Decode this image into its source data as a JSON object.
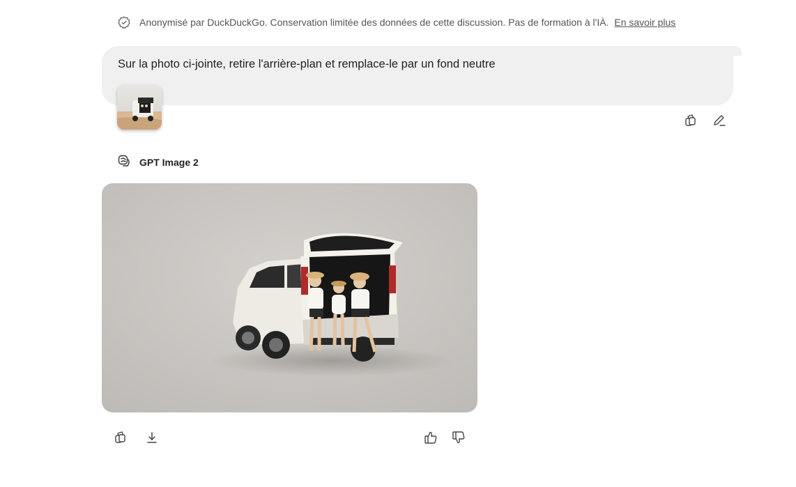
{
  "privacy": {
    "text": "Anonymisé par DuckDuckGo. Conservation limitée des données de cette discussion. Pas de formation à l'IÀ.",
    "link": "En savoir plus",
    "icon": "shield-check-icon"
  },
  "user_message": {
    "text": "Sur la photo ci-jointe, retire l'arrière-plan et remplace-le par un fond neutre",
    "attachment_icon": "photo-thumbnail"
  },
  "message_actions": [
    "copy-icon",
    "edit-icon"
  ],
  "assistant": {
    "model_icon": "model-icon",
    "model_name": "GPT Image 2"
  },
  "image_actions": {
    "left": [
      "copy-icon",
      "download-icon"
    ],
    "right": [
      "thumbs-up-icon",
      "thumbs-down-icon"
    ]
  },
  "colors": {
    "bubble_bg": "#f0f0f0",
    "image_bg": "#c9c6c2",
    "text": "#1f1f1f",
    "muted": "#555555"
  }
}
